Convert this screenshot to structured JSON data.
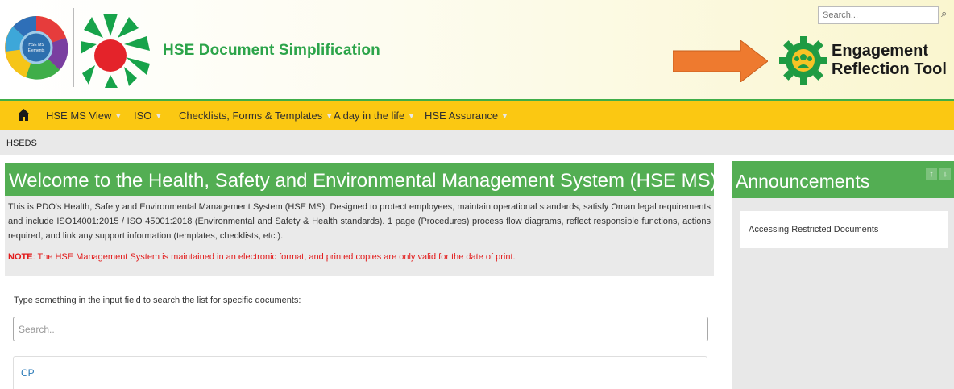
{
  "header": {
    "wheel_label": "HSE MS Elements",
    "site_title": "HSE Document Simplification",
    "ert_line1": "Engagement",
    "ert_line2": "Reflection Tool",
    "search_placeholder": "Search..."
  },
  "nav": {
    "items": [
      {
        "label": "HSE MS View"
      },
      {
        "label": "ISO"
      },
      {
        "label": "Checklists, Forms & Templates"
      },
      {
        "label": "A day in the life"
      },
      {
        "label": "HSE Assurance"
      }
    ],
    "caret": "▼"
  },
  "breadcrumb": "HSEDS",
  "welcome": {
    "title": "Welcome to the Health, Safety and Environmental Management System (HSE MS)",
    "body": "This is PDO's Health, Safety and Environmental Management System (HSE MS): Designed to protect employees, maintain operational standards, satisfy Oman legal requirements and include ISO14001:2015 / ISO 45001:2018 (Environmental and Safety & Health standards). 1 page (Procedures) process flow diagrams, reflect responsible functions, actions required, and link any support information (templates, checklists, etc.).",
    "note_label": "NOTE",
    "note_text": ": The HSE Management System is maintained in an electronic format, and printed copies are only valid for the date of print."
  },
  "docs": {
    "hint": "Type something in the input field to search the list for specific documents:",
    "search_placeholder": "Search..",
    "items": [
      {
        "label": "CP"
      }
    ]
  },
  "announcements": {
    "title": "Announcements",
    "up": "↑",
    "down": "↓",
    "items": [
      {
        "label": "Accessing Restricted Documents"
      }
    ]
  },
  "colors": {
    "brand_green": "#53ae53",
    "nav_yellow": "#fbc812",
    "title_green": "#2ca44a",
    "arrow_orange": "#ee7a2f",
    "note_red": "#e21b1b",
    "link_blue": "#2a7ab8"
  }
}
